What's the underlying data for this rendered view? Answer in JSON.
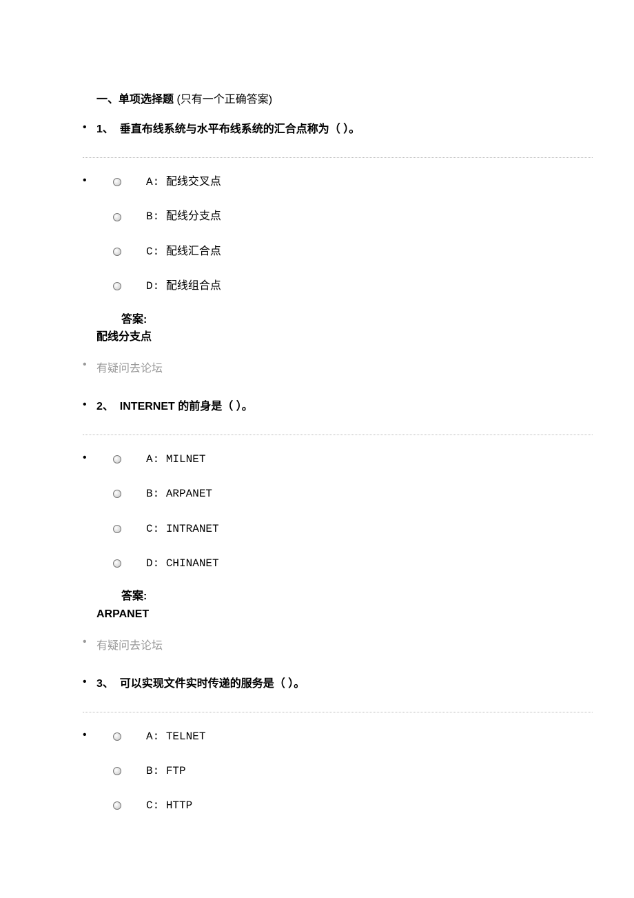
{
  "header": {
    "title": "一、单项选择题",
    "note": "(只有一个正确答案)"
  },
  "forum_link_text": "有疑问去论坛",
  "answer_label": "答案:",
  "questions": [
    {
      "number": "1、",
      "stem": "垂直布线系统与水平布线系统的汇合点称为（ ）。",
      "options": [
        {
          "key": "A",
          "text": "配线交叉点"
        },
        {
          "key": "B",
          "text": "配线分支点"
        },
        {
          "key": "C",
          "text": "配线汇合点"
        },
        {
          "key": "D",
          "text": "配线组合点"
        }
      ],
      "answer": "配线分支点"
    },
    {
      "number": "2、",
      "stem": "INTERNET 的前身是（ ）。",
      "options": [
        {
          "key": "A",
          "text": "MILNET"
        },
        {
          "key": "B",
          "text": "ARPANET"
        },
        {
          "key": "C",
          "text": "INTRANET"
        },
        {
          "key": "D",
          "text": "CHINANET"
        }
      ],
      "answer": "ARPANET"
    },
    {
      "number": "3、",
      "stem": "可以实现文件实时传递的服务是（ ）。",
      "options": [
        {
          "key": "A",
          "text": "TELNET"
        },
        {
          "key": "B",
          "text": "FTP"
        },
        {
          "key": "C",
          "text": "HTTP"
        }
      ],
      "answer": null
    }
  ]
}
